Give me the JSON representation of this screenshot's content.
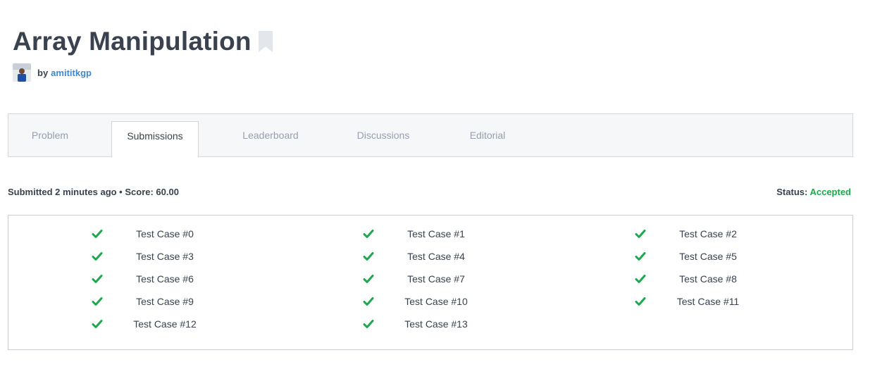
{
  "header": {
    "title": "Array Manipulation",
    "by_label": "by",
    "author": "amititkgp"
  },
  "tabs": [
    {
      "label": "Problem",
      "active": false
    },
    {
      "label": "Submissions",
      "active": true
    },
    {
      "label": "Leaderboard",
      "active": false
    },
    {
      "label": "Discussions",
      "active": false
    },
    {
      "label": "Editorial",
      "active": false
    }
  ],
  "submission": {
    "summary": "Submitted 2 minutes ago • Score: 60.00",
    "status_label": "Status:",
    "status_value": "Accepted"
  },
  "test_cases": [
    {
      "label": "Test Case #0",
      "result": "pass"
    },
    {
      "label": "Test Case #1",
      "result": "pass"
    },
    {
      "label": "Test Case #2",
      "result": "pass"
    },
    {
      "label": "Test Case #3",
      "result": "pass"
    },
    {
      "label": "Test Case #4",
      "result": "pass"
    },
    {
      "label": "Test Case #5",
      "result": "pass"
    },
    {
      "label": "Test Case #6",
      "result": "pass"
    },
    {
      "label": "Test Case #7",
      "result": "pass"
    },
    {
      "label": "Test Case #8",
      "result": "pass"
    },
    {
      "label": "Test Case #9",
      "result": "pass"
    },
    {
      "label": "Test Case #10",
      "result": "pass"
    },
    {
      "label": "Test Case #11",
      "result": "pass"
    },
    {
      "label": "Test Case #12",
      "result": "pass"
    },
    {
      "label": "Test Case #13",
      "result": "pass"
    }
  ],
  "colors": {
    "accent_green": "#1ba94c",
    "link_blue": "#3c89d0",
    "text_dark": "#39424e",
    "tab_inactive": "#979faf"
  },
  "icons": {
    "bookmark": "bookmark-icon",
    "check": "check-icon",
    "avatar": "user-avatar"
  }
}
